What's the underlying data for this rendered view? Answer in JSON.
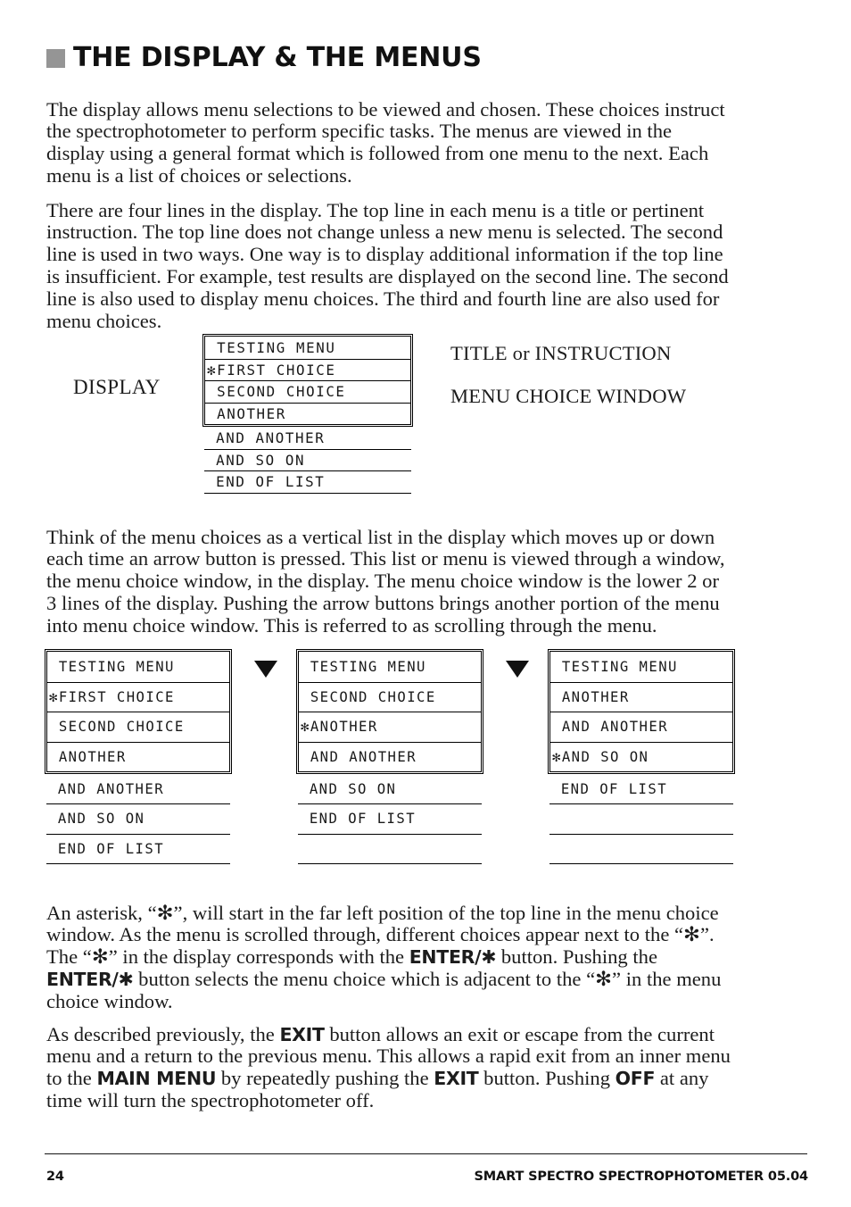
{
  "heading": {
    "bullet_color": "#959595",
    "title": "THE DISPLAY & THE MENUS"
  },
  "paragraphs": {
    "p1": "The display allows menu selections to be viewed and chosen. These choices instruct the spectrophotometer to perform specific tasks. The menus are viewed in the display using a general format which is followed from one menu to the next. Each menu is a list of choices or selections.",
    "p2": "There are four lines in the display. The top line in each menu is a title or pertinent instruction. The top line does not change unless a new menu is selected. The second line is used in two ways. One way is to display additional information if the top line is insufficient. For example, test results are displayed on the second line. The second line is also used to display menu choices. The third and fourth line are also used for menu choices.",
    "p3": "Think of the menu choices as a vertical list in the display which moves up or down each time an arrow button is pressed. This list or menu is viewed through a window, the menu choice window, in the display. The menu choice window is the lower 2 or 3 lines of the display. Pushing the arrow buttons brings another portion of the menu into menu choice window. This is referred to as scrolling through the menu.",
    "p4_seg1": "An asterisk, “",
    "p4_ast1": "✻",
    "p4_seg2": "”, will start in the far left position of the top line in the menu choice window. As the menu is scrolled through, different choices appear next to the “",
    "p4_ast2": "✻",
    "p4_seg3": "”. The “",
    "p4_ast3": "✻",
    "p4_seg4": "” in the display corresponds with the ",
    "p4_bold1": "ENTER/✱",
    "p4_seg5": " button. Pushing the ",
    "p4_bold2": "ENTER/✱",
    "p4_seg6": " button selects the menu choice which is adjacent to the “",
    "p4_ast4": "✻",
    "p4_seg7": "” in the menu choice window.",
    "p5_seg1": "As described previously, the ",
    "p5_bold1": "EXIT",
    "p5_seg2": "  button allows an exit or escape from the current menu and a return to the previous menu. This allows a rapid exit from an inner menu to the ",
    "p5_bold2": "MAIN MENU",
    "p5_seg3": " by repeatedly pushing the ",
    "p5_bold3": "EXIT",
    "p5_seg4": "  button. Pushing  ",
    "p5_bold4": "OFF",
    "p5_seg5": " at any time will turn the spectrophotometer off."
  },
  "display_diagram": {
    "label": "DISPLAY",
    "annotation_title": "TITLE or INSTRUCTION",
    "annotation_window": "MENU CHOICE WINDOW",
    "window_rows": [
      " TESTING MENU",
      "✻FIRST CHOICE",
      " SECOND CHOICE",
      " ANOTHER"
    ],
    "tail_rows": [
      " AND ANOTHER",
      " AND SO ON",
      " END OF LIST"
    ]
  },
  "scroll_panels": [
    {
      "name": "panel-step-1",
      "window_rows": [
        " TESTING MENU",
        "✻FIRST CHOICE",
        " SECOND CHOICE",
        " ANOTHER"
      ],
      "tail_rows": [
        " AND ANOTHER",
        " AND SO ON",
        " END OF LIST"
      ]
    },
    {
      "name": "panel-step-2",
      "window_rows": [
        " TESTING MENU",
        " SECOND CHOICE",
        "✻ANOTHER",
        " AND ANOTHER"
      ],
      "tail_rows": [
        " AND SO ON",
        " END OF LIST",
        ""
      ]
    },
    {
      "name": "panel-step-3",
      "window_rows": [
        " TESTING MENU",
        " ANOTHER",
        " AND ANOTHER",
        "✻AND SO ON"
      ],
      "tail_rows": [
        " END OF LIST",
        "",
        ""
      ]
    }
  ],
  "arrows": {
    "glyph": "down-triangle",
    "count": 2
  },
  "footer": {
    "page_number": "24",
    "document_title": "SMART SPECTRO SPECTROPHOTOMETER  05.04"
  }
}
